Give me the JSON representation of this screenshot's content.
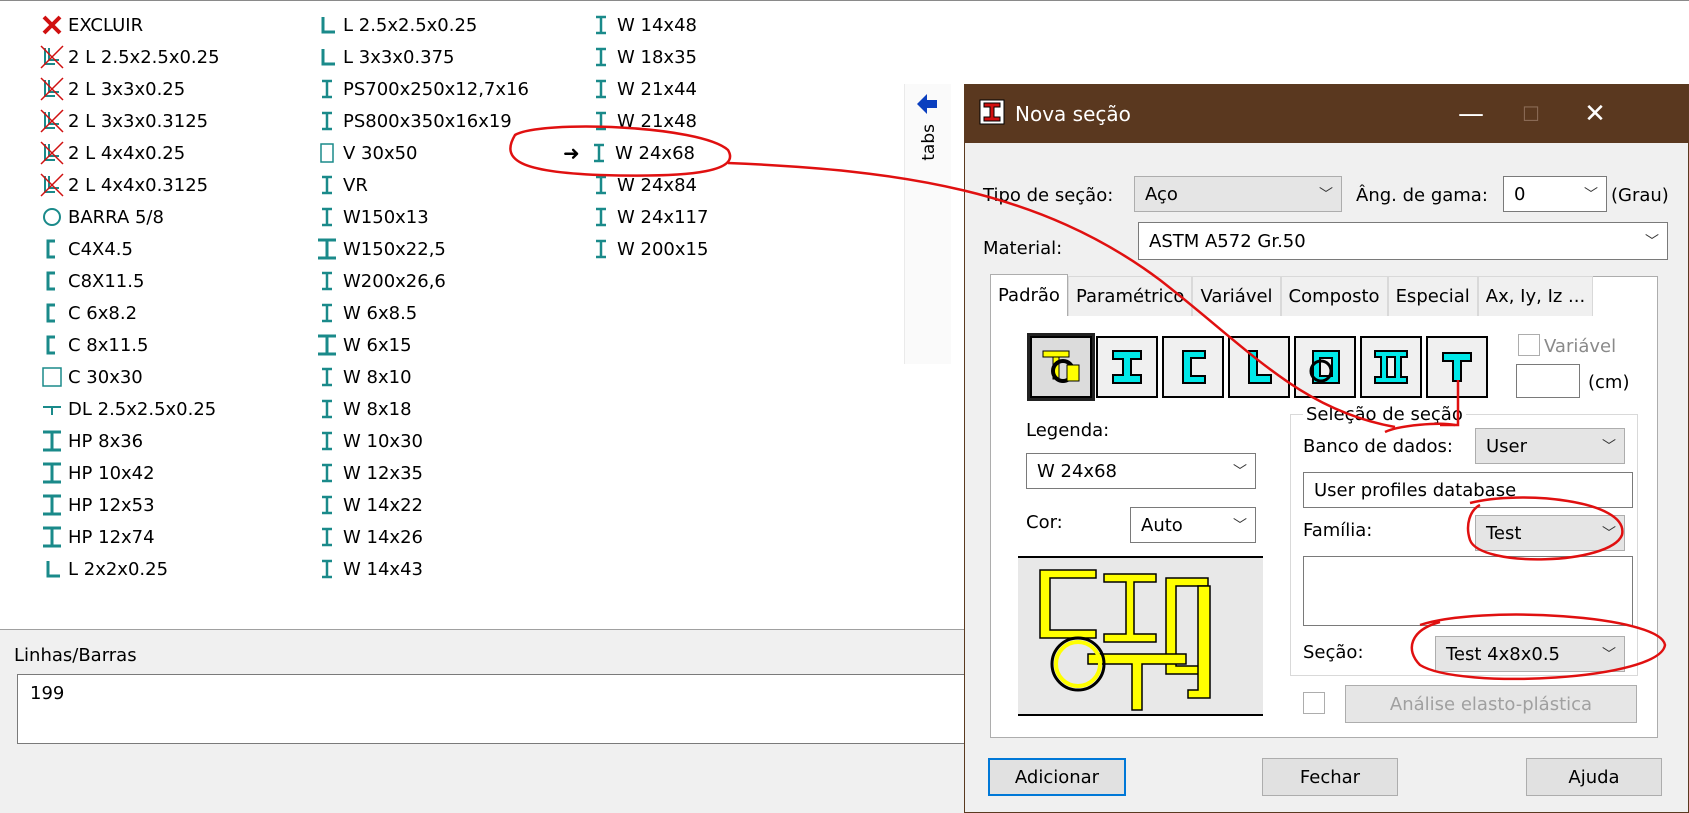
{
  "section_list": {
    "col1": [
      {
        "label": "EXCLUIR",
        "icon": "delete-x-icon"
      },
      {
        "label": "2 L 2.5x2.5x0.25",
        "icon": "double-angle-crossed-icon"
      },
      {
        "label": "2 L 3x3x0.25",
        "icon": "double-angle-crossed-icon"
      },
      {
        "label": "2 L 3x3x0.3125",
        "icon": "double-angle-crossed-icon"
      },
      {
        "label": "2 L 4x4x0.25",
        "icon": "double-angle-crossed-icon"
      },
      {
        "label": "2 L 4x4x0.3125",
        "icon": "double-angle-crossed-icon"
      },
      {
        "label": "BARRA 5/8",
        "icon": "circle-bar-icon"
      },
      {
        "label": "C4X4.5",
        "icon": "channel-icon"
      },
      {
        "label": "C8X11.5",
        "icon": "channel-icon"
      },
      {
        "label": "C 6x8.2",
        "icon": "channel-icon"
      },
      {
        "label": "C 8x11.5",
        "icon": "channel-icon"
      },
      {
        "label": "C 30x30",
        "icon": "square-tube-icon"
      },
      {
        "label": "DL 2.5x2.5x0.25",
        "icon": "tee-icon"
      },
      {
        "label": "HP 8x36",
        "icon": "wide-i-beam-icon"
      },
      {
        "label": "HP 10x42",
        "icon": "wide-i-beam-icon"
      },
      {
        "label": "HP 12x53",
        "icon": "wide-i-beam-icon"
      },
      {
        "label": "HP 12x74",
        "icon": "wide-i-beam-icon"
      },
      {
        "label": "L 2x2x0.25",
        "icon": "angle-icon"
      }
    ],
    "col2": [
      {
        "label": "L 2.5x2.5x0.25",
        "icon": "angle-icon"
      },
      {
        "label": "L 3x3x0.375",
        "icon": "angle-icon"
      },
      {
        "label": "PS700x250x12,7x16",
        "icon": "i-beam-icon"
      },
      {
        "label": "PS800x350x16x19",
        "icon": "i-beam-icon"
      },
      {
        "label": "V 30x50",
        "icon": "rectangle-icon"
      },
      {
        "label": "VR",
        "icon": "i-beam-icon"
      },
      {
        "label": "W150x13",
        "icon": "i-beam-icon"
      },
      {
        "label": "W150x22,5",
        "icon": "wide-i-beam-icon"
      },
      {
        "label": "W200x26,6",
        "icon": "i-beam-icon"
      },
      {
        "label": "W 6x8.5",
        "icon": "i-beam-icon"
      },
      {
        "label": "W 6x15",
        "icon": "wide-i-beam-icon"
      },
      {
        "label": "W 8x10",
        "icon": "i-beam-icon"
      },
      {
        "label": "W 8x18",
        "icon": "i-beam-icon"
      },
      {
        "label": "W 10x30",
        "icon": "i-beam-icon"
      },
      {
        "label": "W 12x35",
        "icon": "i-beam-icon"
      },
      {
        "label": "W 14x22",
        "icon": "i-beam-icon"
      },
      {
        "label": "W 14x26",
        "icon": "i-beam-icon"
      },
      {
        "label": "W 14x43",
        "icon": "i-beam-icon"
      }
    ],
    "col3": [
      {
        "label": "W 14x48",
        "icon": "i-beam-icon"
      },
      {
        "label": "W 18x35",
        "icon": "i-beam-icon"
      },
      {
        "label": "W 21x44",
        "icon": "i-beam-icon"
      },
      {
        "label": "W 21x48",
        "icon": "i-beam-icon"
      },
      {
        "label": "W 24x68",
        "icon": "i-beam-icon",
        "current": true
      },
      {
        "label": "W 24x84",
        "icon": "i-beam-icon"
      },
      {
        "label": "W 24x117",
        "icon": "i-beam-icon"
      },
      {
        "label": "W 200x15",
        "icon": "i-beam-icon"
      }
    ],
    "current_marker": "➜"
  },
  "side_tab": {
    "label": "tabs",
    "icon": "back-arrow-icon"
  },
  "lines_bars": {
    "title": "Linhas/Barras",
    "value": "199"
  },
  "dialog": {
    "title": "Nova seção",
    "controls": {
      "minimize": "—",
      "maximize": "☐",
      "close": "✕"
    },
    "tipo_label": "Tipo de seção:",
    "tipo_value": "Aço",
    "gama_label": "Âng. de gama:",
    "gama_value": "0",
    "gama_unit": "(Grau)",
    "material_label": "Material:",
    "material_value": "ASTM A572 Gr.50",
    "tabs": [
      "Padrão",
      "Paramétrico",
      "Variável",
      "Composto",
      "Especial",
      "Ax, Iy, Iz ..."
    ],
    "active_tab": 0,
    "section_type_buttons": [
      "multi-shape-icon",
      "i-section-icon",
      "channel-section-icon",
      "angle-section-icon",
      "tube-section-icon",
      "double-i-section-icon",
      "tee-section-icon"
    ],
    "variavel_label": "Variável",
    "unit_cm": "(cm)",
    "legenda_label": "Legenda:",
    "legenda_value": "W 24x68",
    "cor_label": "Cor:",
    "cor_value": "Auto",
    "selecao_title": "Seleção de seção",
    "banco_label": "Banco de dados:",
    "banco_value": "User",
    "banco_desc": "User profiles database",
    "familia_label": "Família:",
    "familia_value": "Test",
    "secao_label": "Seção:",
    "secao_value": "Test 4x8x0.5",
    "elasto_label": "Análise elasto-plástica",
    "buttons": {
      "add": "Adicionar",
      "close": "Fechar",
      "help": "Ajuda"
    }
  },
  "colors": {
    "teal_icon": "#1a8a8a",
    "annotation_red": "#e01010",
    "titlebar": "#5a381f",
    "section_yellow": "#ffff00",
    "section_cyan": "#00e8e8"
  }
}
